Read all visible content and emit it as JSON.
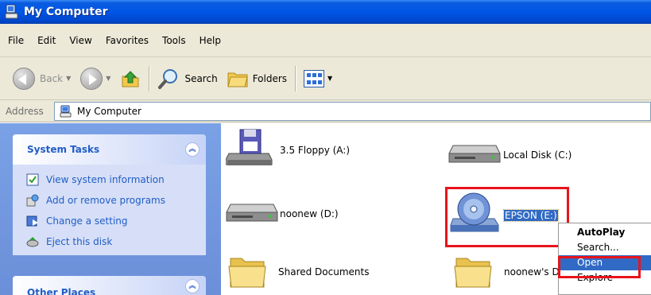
{
  "window": {
    "title": "My Computer"
  },
  "menubar": {
    "items": [
      "File",
      "Edit",
      "View",
      "Favorites",
      "Tools",
      "Help"
    ]
  },
  "toolbar": {
    "back_label": "Back",
    "search_label": "Search",
    "folders_label": "Folders"
  },
  "address": {
    "label": "Address",
    "value": "My Computer"
  },
  "left_pane": {
    "system_tasks": {
      "title": "System Tasks",
      "items": [
        {
          "label": "View system information",
          "icon": "system-info-icon"
        },
        {
          "label": "Add or remove programs",
          "icon": "add-remove-programs-icon"
        },
        {
          "label": "Change a setting",
          "icon": "control-panel-icon"
        },
        {
          "label": "Eject this disk",
          "icon": "eject-disk-icon"
        }
      ]
    },
    "other_places": {
      "title": "Other Places"
    }
  },
  "drives": [
    {
      "label": "3.5 Floppy (A:)",
      "icon": "floppy-drive-icon"
    },
    {
      "label": "Local Disk (C:)",
      "icon": "hard-disk-icon"
    },
    {
      "label": "noonew (D:)",
      "icon": "hard-disk-icon"
    },
    {
      "label": "EPSON (E:)",
      "icon": "cd-drive-icon",
      "selected": true
    },
    {
      "label": "Shared Documents",
      "icon": "folder-icon"
    },
    {
      "label": "noonew's D",
      "icon": "folder-icon"
    }
  ],
  "context_menu": {
    "items": [
      {
        "label": "AutoPlay",
        "default": true
      },
      {
        "label": "Search..."
      },
      {
        "label": "Open",
        "active": true
      },
      {
        "label": "Explore"
      }
    ]
  },
  "colors": {
    "title_bar": "#0055e5",
    "task_link": "#215dc6",
    "selection": "#316ac5",
    "highlight_box": "#e8141a"
  }
}
